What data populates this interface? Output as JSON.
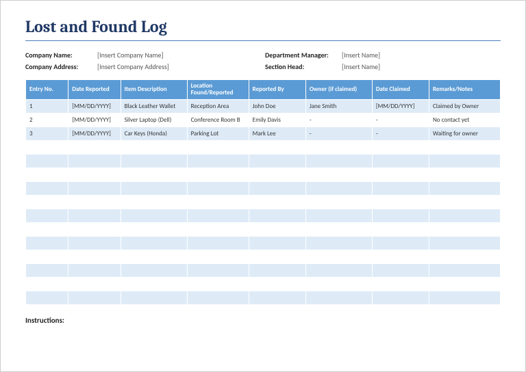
{
  "title": "Lost and Found Log",
  "meta": {
    "company_name_label": "Company Name:",
    "company_name_value": "[Insert Company Name]",
    "company_address_label": "Company Address:",
    "company_address_value": "[Insert Company Address]",
    "dept_manager_label": "Department Manager:",
    "dept_manager_value": "[Insert Name]",
    "section_head_label": "Section Head:",
    "section_head_value": "[Insert Name]"
  },
  "headers": [
    "Entry No.",
    "Date Reported",
    "Item Description",
    "Location Found/Reported",
    "Reported By",
    "Owner (if claimed)",
    "Date Claimed",
    "Remarks/Notes"
  ],
  "rows": [
    [
      "1",
      "[MM/DD/YYYY]",
      "Black Leather Wallet",
      "Reception Area",
      "John Doe",
      "Jane Smith",
      "[MM/DD/YYYY]",
      "Claimed by Owner"
    ],
    [
      "2",
      "[MM/DD/YYYY]",
      "Silver Laptop (Dell)",
      "Conference Room B",
      "Emily Davis",
      "-",
      "-",
      "No contact yet"
    ],
    [
      "3",
      "[MM/DD/YYYY]",
      "Car Keys (Honda)",
      "Parking Lot",
      "Mark Lee",
      "-",
      "-",
      "Waiting for owner"
    ],
    [
      "",
      "",
      "",
      "",
      "",
      "",
      "",
      ""
    ],
    [
      "",
      "",
      "",
      "",
      "",
      "",
      "",
      ""
    ],
    [
      "",
      "",
      "",
      "",
      "",
      "",
      "",
      ""
    ],
    [
      "",
      "",
      "",
      "",
      "",
      "",
      "",
      ""
    ],
    [
      "",
      "",
      "",
      "",
      "",
      "",
      "",
      ""
    ],
    [
      "",
      "",
      "",
      "",
      "",
      "",
      "",
      ""
    ],
    [
      "",
      "",
      "",
      "",
      "",
      "",
      "",
      ""
    ],
    [
      "",
      "",
      "",
      "",
      "",
      "",
      "",
      ""
    ],
    [
      "",
      "",
      "",
      "",
      "",
      "",
      "",
      ""
    ],
    [
      "",
      "",
      "",
      "",
      "",
      "",
      "",
      ""
    ],
    [
      "",
      "",
      "",
      "",
      "",
      "",
      "",
      ""
    ],
    [
      "",
      "",
      "",
      "",
      "",
      "",
      "",
      ""
    ]
  ],
  "instructions_label": "Instructions:"
}
